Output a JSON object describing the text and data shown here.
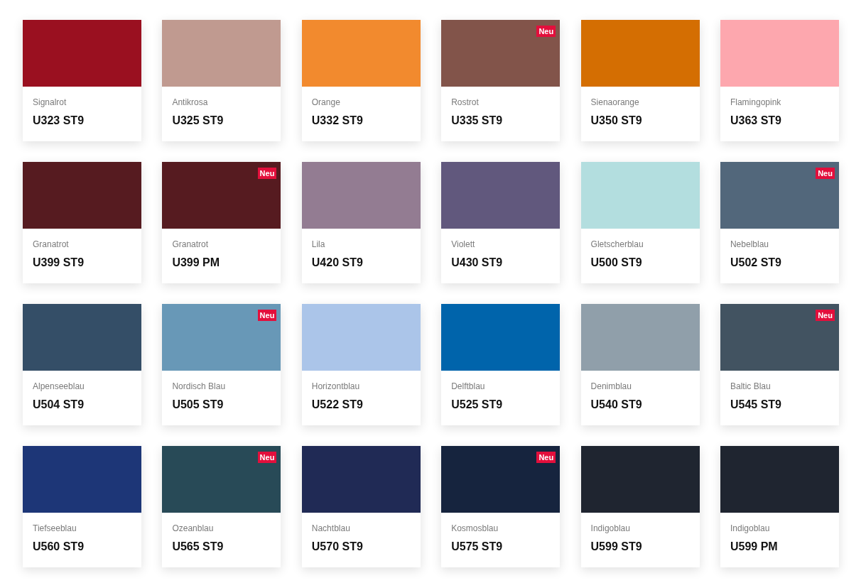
{
  "swatches": [
    {
      "name": "Signalrot",
      "code": "U323 ST9",
      "color": "#9a1020"
    },
    {
      "name": "Antikrosa",
      "code": "U325 ST9",
      "color": "#c09a90"
    },
    {
      "name": "Orange",
      "code": "U332 ST9",
      "color": "#f28a2e"
    },
    {
      "name": "Rostrot",
      "code": "U335 ST9",
      "color": "#82544a",
      "badge": "Neu"
    },
    {
      "name": "Sienaorange",
      "code": "U350 ST9",
      "color": "#d46e02"
    },
    {
      "name": "Flamingopink",
      "code": "U363 ST9",
      "color": "#fda7ae"
    },
    {
      "name": "Granatrot",
      "code": "U399 ST9",
      "color": "#561b20"
    },
    {
      "name": "Granatrot",
      "code": "U399 PM",
      "color": "#561b20",
      "badge": "Neu"
    },
    {
      "name": "Lila",
      "code": "U420 ST9",
      "color": "#937c92"
    },
    {
      "name": "Violett",
      "code": "U430 ST9",
      "color": "#61587d"
    },
    {
      "name": "Gletscherblau",
      "code": "U500 ST9",
      "color": "#b3dedf"
    },
    {
      "name": "Nebelblau",
      "code": "U502 ST9",
      "color": "#52677b",
      "badge": "Neu"
    },
    {
      "name": "Alpenseeblau",
      "code": "U504 ST9",
      "color": "#344e67"
    },
    {
      "name": "Nordisch Blau",
      "code": "U505 ST9",
      "color": "#6898b7",
      "badge": "Neu"
    },
    {
      "name": "Horizontblau",
      "code": "U522 ST9",
      "color": "#abc5e9"
    },
    {
      "name": "Delftblau",
      "code": "U525 ST9",
      "color": "#0064ab"
    },
    {
      "name": "Denimblau",
      "code": "U540 ST9",
      "color": "#909faa"
    },
    {
      "name": "Baltic Blau",
      "code": "U545 ST9",
      "color": "#425361",
      "badge": "Neu"
    },
    {
      "name": "Tiefseeblau",
      "code": "U560 ST9",
      "color": "#1d3677"
    },
    {
      "name": "Ozeanblau",
      "code": "U565 ST9",
      "color": "#284a57",
      "badge": "Neu"
    },
    {
      "name": "Nachtblau",
      "code": "U570 ST9",
      "color": "#202a55"
    },
    {
      "name": "Kosmosblau",
      "code": "U575 ST9",
      "color": "#16243e",
      "badge": "Neu"
    },
    {
      "name": "Indigoblau",
      "code": "U599 ST9",
      "color": "#1f2530"
    },
    {
      "name": "Indigoblau",
      "code": "U599 PM",
      "color": "#1f2530"
    }
  ]
}
